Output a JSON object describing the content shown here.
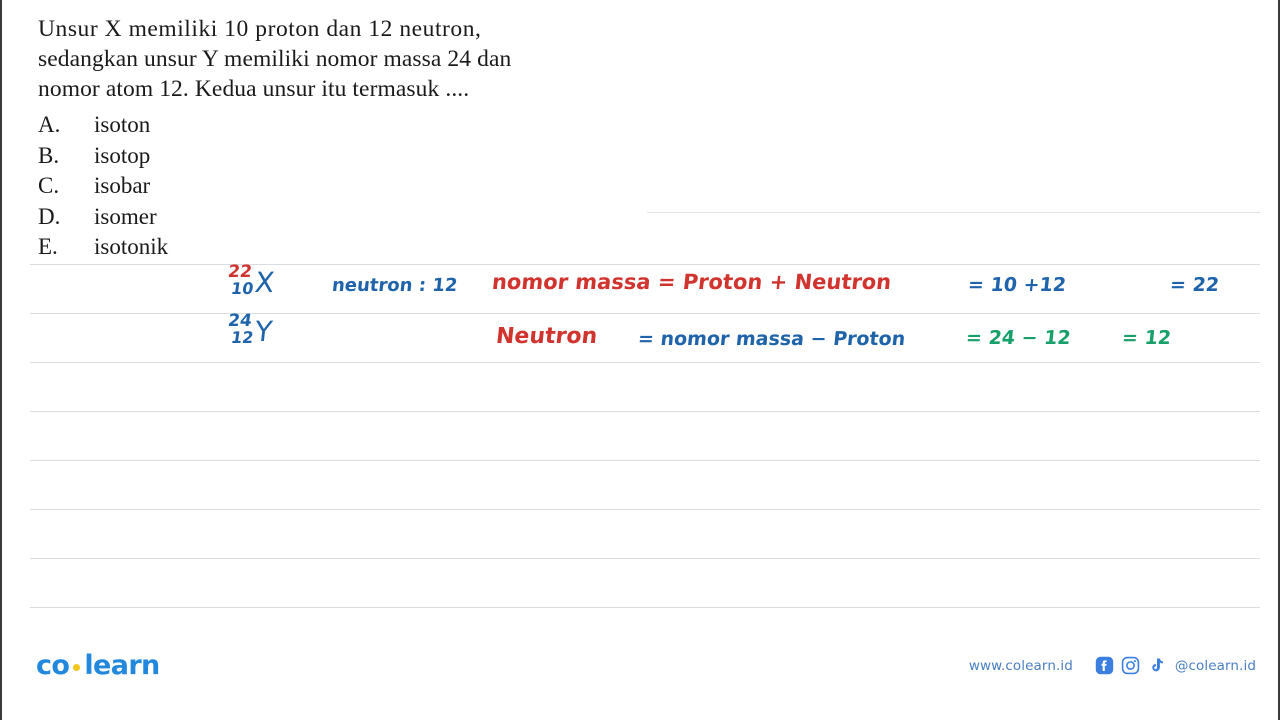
{
  "question": {
    "lines": [
      "Unsur X memiliki 10 proton dan 12 neutron,",
      "sedangkan unsur Y memiliki nomor massa 24 dan",
      "nomor atom 12. Kedua unsur itu termasuk ...."
    ]
  },
  "options": [
    {
      "letter": "A.",
      "text": "isoton"
    },
    {
      "letter": "B.",
      "text": "isotop"
    },
    {
      "letter": "C.",
      "text": "isobar"
    },
    {
      "letter": "D.",
      "text": "isomer"
    },
    {
      "letter": "E.",
      "text": "isotonik"
    }
  ],
  "annotations": {
    "row1": {
      "isotope": {
        "mass": "22",
        "atomic": "10",
        "symbol": "X",
        "mass_color": "#d1332e",
        "atomic_color": "#1f64ab",
        "symbol_color": "#1f64ab"
      },
      "neutron_note": "neutron : 12",
      "formula": "nomor massa  =  Proton + Neutron",
      "calc": "=   10 +12",
      "result": "=  22"
    },
    "row2": {
      "isotope": {
        "mass": "24",
        "atomic": "12",
        "symbol": "Y",
        "mass_color": "#1f64ab",
        "atomic_color": "#1f64ab",
        "symbol_color": "#1f64ab"
      },
      "label": "Neutron",
      "formula": "= nomor massa  −  Proton",
      "calc": "= 24 − 12",
      "result": "= 12"
    }
  },
  "footer": {
    "logo_left": "co",
    "logo_right": "learn",
    "url": "www.colearn.id",
    "handle": "@colearn.id",
    "icons": [
      "facebook-icon",
      "instagram-icon",
      "tiktok-icon"
    ]
  },
  "colors": {
    "red": "#d1332e",
    "blue": "#1f64ab",
    "green": "#18a06a",
    "brand_blue": "#2288dd",
    "brand_yellow": "#f5c518",
    "rule_gray": "#d9dde1"
  }
}
